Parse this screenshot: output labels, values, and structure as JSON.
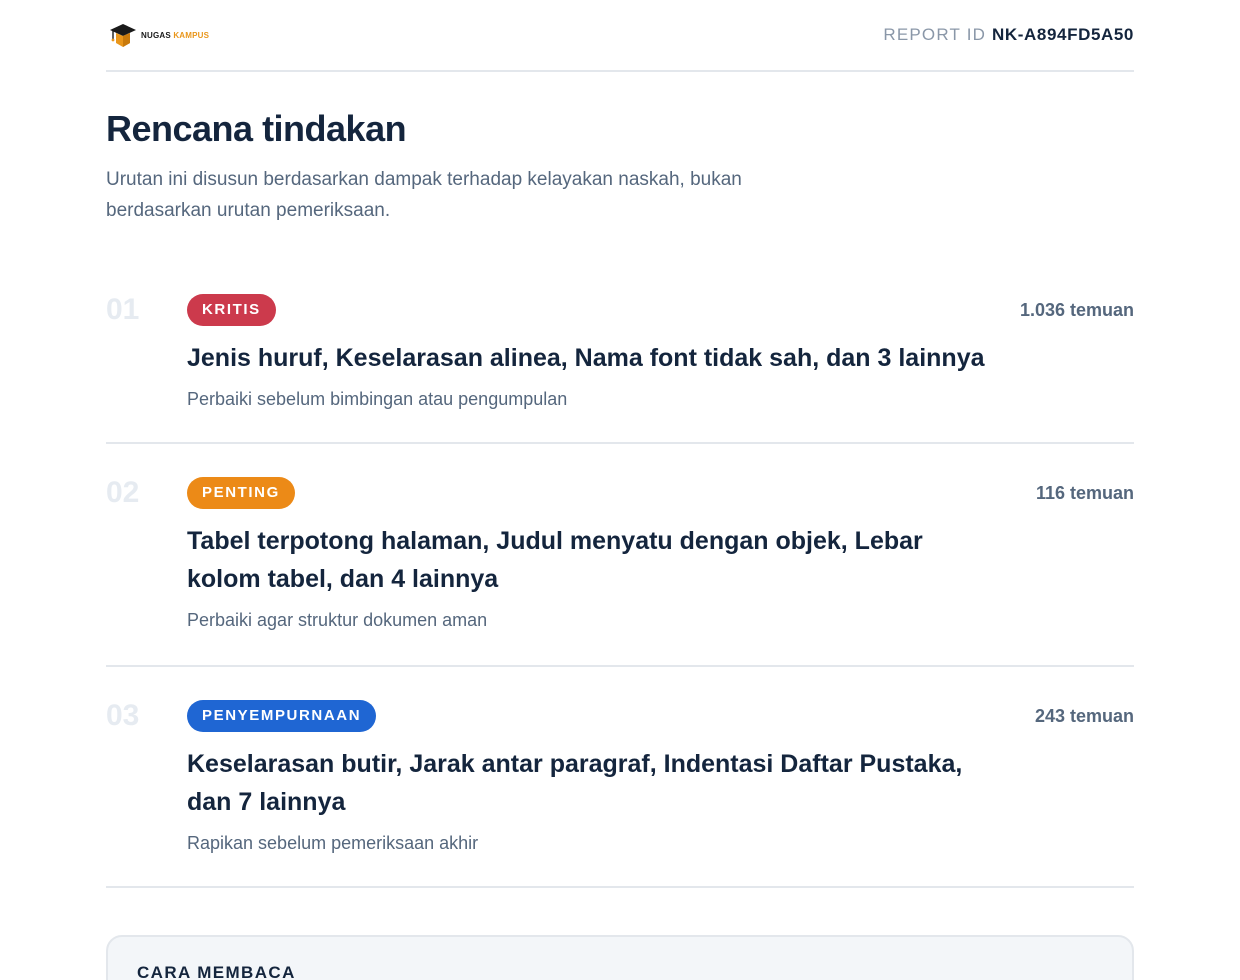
{
  "header": {
    "brand_name": "NUGAS",
    "brand_accent": "KAMPUS",
    "report_id_label": "REPORT ID",
    "report_id_value": "NK-A894FD5A50"
  },
  "page": {
    "title": "Rencana tindakan",
    "subtitle": "Urutan ini disusun berdasarkan dampak terhadap kelayakan naskah, bukan berdasarkan urutan pemeriksaan."
  },
  "actions": [
    {
      "number": "01",
      "badge": "KRITIS",
      "badge_color": "#cc3a4c",
      "title": "Jenis huruf, Keselarasan alinea, Nama font tidak sah, dan 3 lainnya",
      "description": "Perbaiki sebelum bimbingan atau pengumpulan",
      "count": "1.036 temuan"
    },
    {
      "number": "02",
      "badge": "PENTING",
      "badge_color": "#ec8a17",
      "title": "Tabel terpotong halaman, Judul menyatu dengan objek, Lebar kolom tabel, dan 4 lainnya",
      "description": "Perbaiki agar struktur dokumen aman",
      "count": "116 temuan"
    },
    {
      "number": "03",
      "badge": "PENYEMPURNAAN",
      "badge_color": "#1f66d3",
      "title": "Keselarasan butir, Jarak antar paragraf, Indentasi Daftar Pustaka, dan 7 lainnya",
      "description": "Rapikan sebelum pemeriksaan akhir",
      "count": "243 temuan"
    }
  ],
  "info_box": {
    "title": "CARA MEMBACA"
  }
}
